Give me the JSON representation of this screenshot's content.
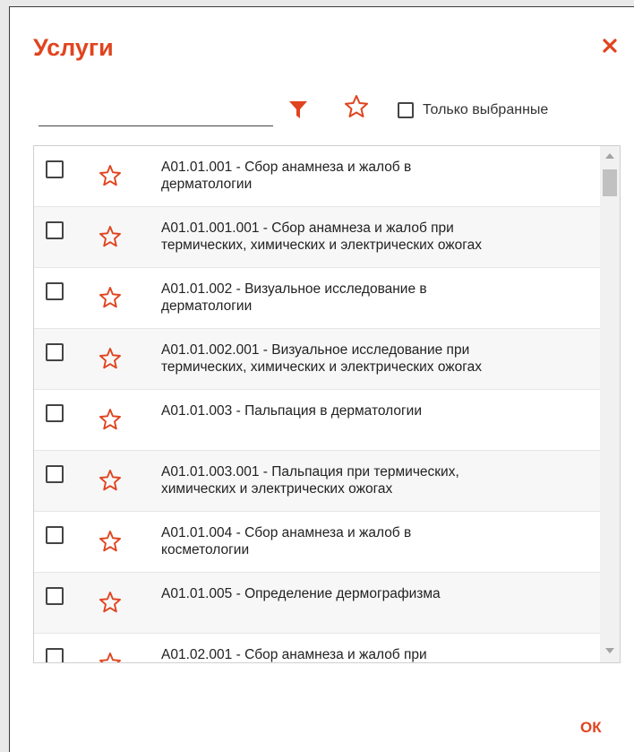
{
  "dialog": {
    "title": "Услуги",
    "close_icon": "close-icon",
    "accent_color": "#e0441f"
  },
  "toolbar": {
    "search_value": "",
    "filter_icon": "filter-icon",
    "favorite_icon": "star-outline-icon",
    "only_selected_label": "Только выбранные",
    "only_selected_checked": false
  },
  "services": [
    {
      "line1": "A01.01.001 - Сбор анамнеза и жалоб в",
      "line2": "дерматологии",
      "checked": false
    },
    {
      "line1": "A01.01.001.001 - Сбор анамнеза и жалоб при",
      "line2": "термических, химических и электрических ожогах",
      "checked": false
    },
    {
      "line1": "A01.01.002 - Визуальное исследование в",
      "line2": "дерматологии",
      "checked": false
    },
    {
      "line1": "A01.01.002.001 - Визуальное исследование при",
      "line2": "термических, химических и электрических ожогах",
      "checked": false
    },
    {
      "line1": "A01.01.003 - Пальпация в дерматологии",
      "line2": "",
      "checked": false
    },
    {
      "line1": "A01.01.003.001 - Пальпация при термических,",
      "line2": "химических и электрических ожогах",
      "checked": false
    },
    {
      "line1": "A01.01.004 - Сбор анамнеза и жалоб в",
      "line2": "косметологии",
      "checked": false
    },
    {
      "line1": "A01.01.005 - Определение дермографизма",
      "line2": "",
      "checked": false
    },
    {
      "line1": "A01.02.001 - Сбор анамнеза и жалоб при",
      "line2": "",
      "checked": false
    }
  ],
  "footer": {
    "ok_label": "ОК"
  }
}
